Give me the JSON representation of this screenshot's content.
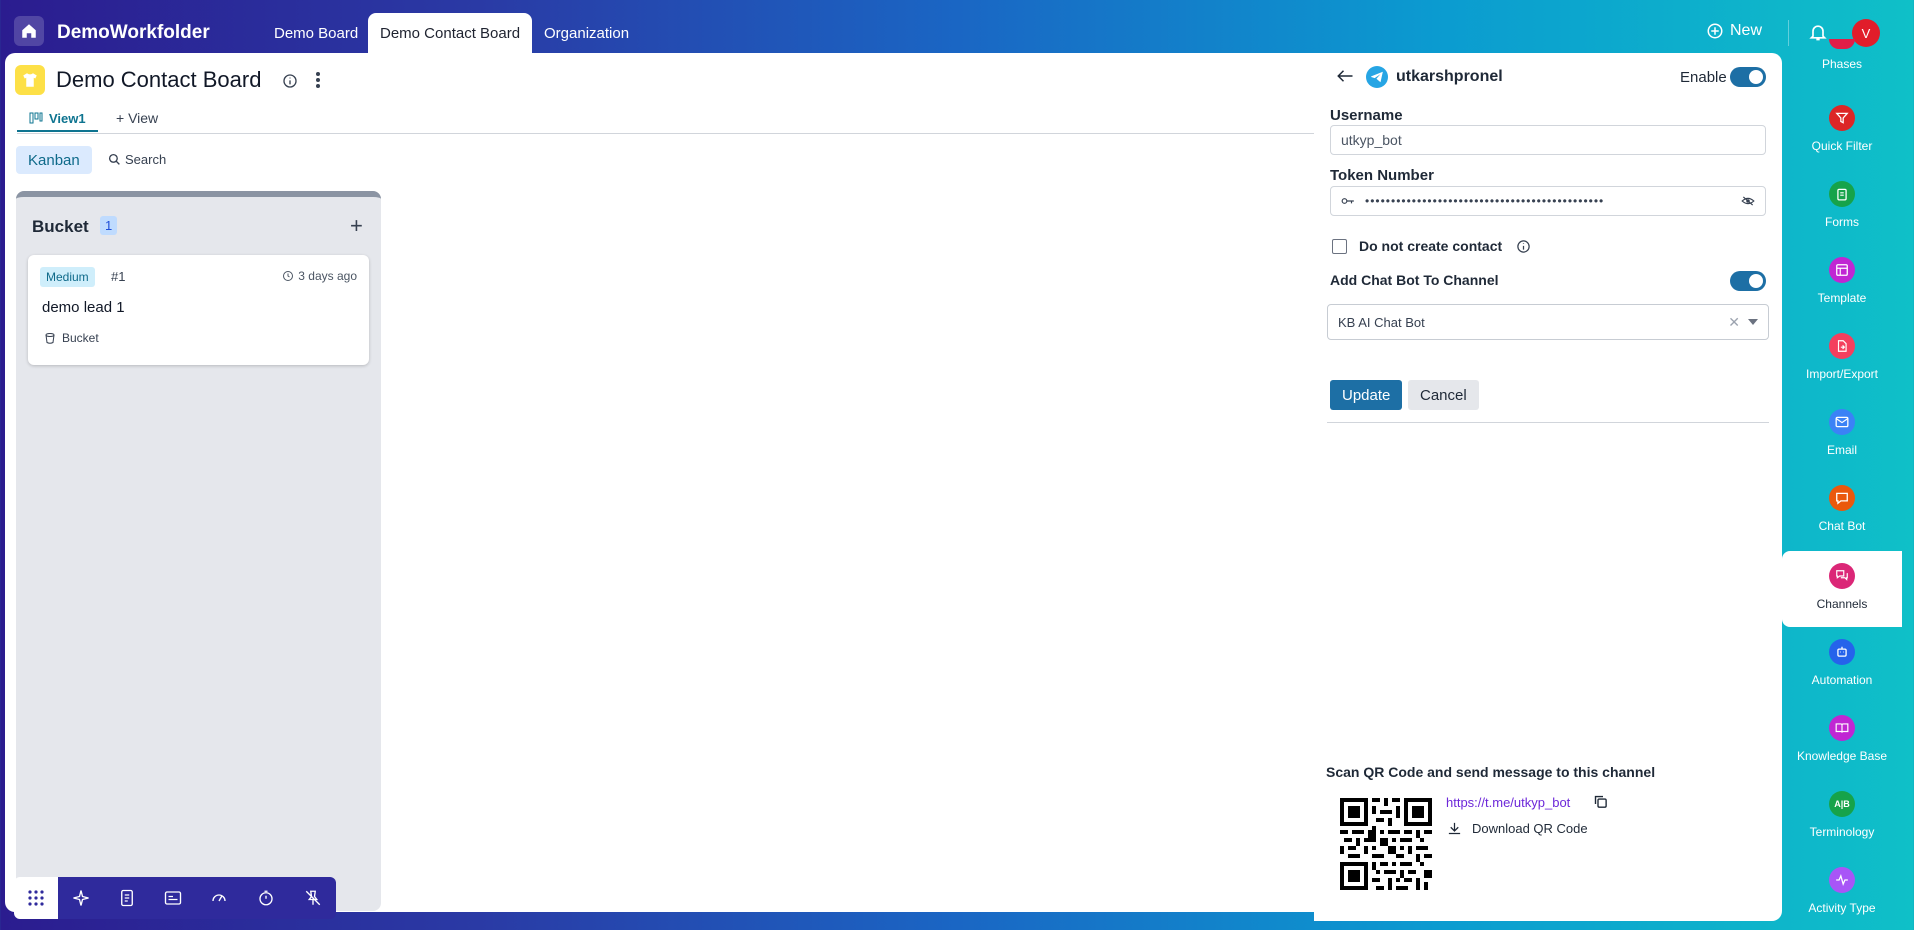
{
  "topbar": {
    "app_name": "DemoWorkfolder",
    "tabs": [
      "Demo Board",
      "Demo Contact Board",
      "Organization"
    ],
    "new_label": "New",
    "avatar_initial": "V"
  },
  "board": {
    "title": "Demo Contact Board",
    "view_tab": "View1",
    "add_view": "+ View",
    "kanban_label": "Kanban",
    "search_label": "Search",
    "column": {
      "title": "Bucket",
      "count": "1",
      "card": {
        "priority": "Medium",
        "number": "#1",
        "time": "3 days ago",
        "name": "demo lead 1",
        "bucket": "Bucket"
      }
    }
  },
  "channel_panel": {
    "title": "utkarshpronel",
    "enable_label": "Enable",
    "username_label": "Username",
    "username_value": "utkyp_bot",
    "token_label": "Token Number",
    "token_mask": "••••••••••••••••••••••••••••••••••••••••••••••",
    "do_not_create_label": "Do not create contact",
    "add_chatbot_label": "Add Chat Bot To Channel",
    "chatbot_value": "KB AI Chat Bot",
    "update_label": "Update",
    "cancel_label": "Cancel",
    "qr_title": "Scan QR Code and send message to this channel",
    "qr_link": "https://t.me/utkyp_bot",
    "download_label": "Download QR Code"
  },
  "sidenav": {
    "items": [
      {
        "label": "Phases",
        "color": "#e11d48"
      },
      {
        "label": "Quick Filter",
        "color": "#dc2626"
      },
      {
        "label": "Forms",
        "color": "#16a34a"
      },
      {
        "label": "Template",
        "color": "#c026d3"
      },
      {
        "label": "Import/Export",
        "color": "#f43f5e"
      },
      {
        "label": "Email",
        "color": "#3b82f6"
      },
      {
        "label": "Chat Bot",
        "color": "#ea580c"
      },
      {
        "label": "Channels",
        "color": "#db2777"
      },
      {
        "label": "Automation",
        "color": "#2563eb"
      },
      {
        "label": "Knowledge Base",
        "color": "#c026d3"
      },
      {
        "label": "Terminology",
        "color": "#16a34a"
      },
      {
        "label": "Activity Type",
        "color": "#a855f7"
      }
    ]
  }
}
